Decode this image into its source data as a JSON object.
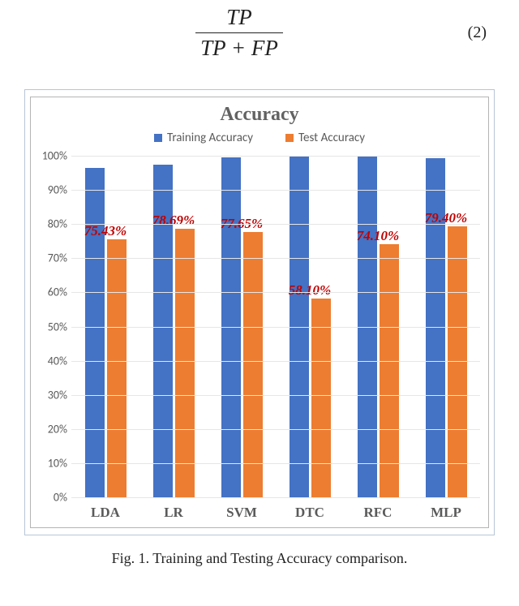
{
  "equation": {
    "numerator": "TP",
    "denominator": "TP + FP",
    "number": "(2)"
  },
  "chart_data": {
    "type": "bar",
    "title": "Accuracy",
    "ylabel_format": "percent",
    "ylim": [
      0,
      100
    ],
    "yticks": [
      0,
      10,
      20,
      30,
      40,
      50,
      60,
      70,
      80,
      90,
      100
    ],
    "categories": [
      "LDA",
      "LR",
      "SVM",
      "DTC",
      "RFC",
      "MLP"
    ],
    "series": [
      {
        "name": "Training Accuracy",
        "color": "#4472c4",
        "values": [
          96.5,
          97.5,
          99.5,
          100,
          100,
          99.3
        ]
      },
      {
        "name": "Test Accuracy",
        "color": "#ed7d31",
        "values": [
          75.43,
          78.69,
          77.65,
          58.1,
          74.1,
          79.4
        ]
      }
    ],
    "test_labels": [
      "75.43%",
      "78.69%",
      "77.65%",
      "58.10%",
      "74.10%",
      "79.40%"
    ]
  },
  "caption": "Fig.  1. Training and Testing Accuracy comparison."
}
